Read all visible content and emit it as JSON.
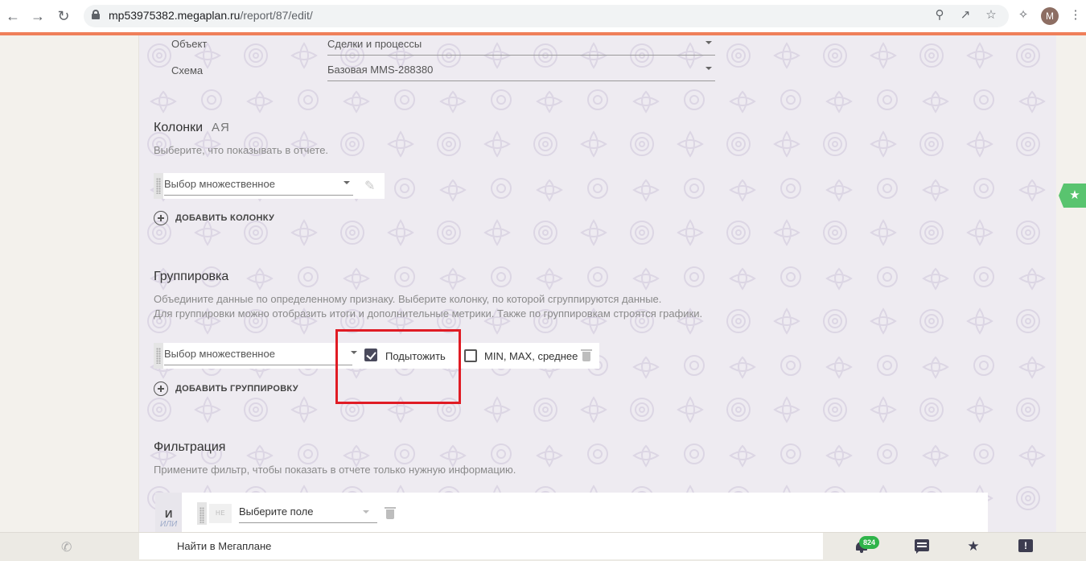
{
  "browser": {
    "url_host": "mp53975382.megaplan.ru",
    "url_path": "/report/87/edit/",
    "profile_initial": "M",
    "icons": [
      "back-icon",
      "forward-icon",
      "reload-icon",
      "lock-icon",
      "zoom-icon",
      "share-icon",
      "bookmark-star-icon",
      "extensions-icon",
      "menu-icon"
    ]
  },
  "form": {
    "object_label": "Объект",
    "object_value": "Сделки и процессы",
    "scheme_label": "Схема",
    "scheme_value": "Базовая MMS-288380"
  },
  "columns": {
    "title": "Колонки",
    "sort_icon_label": "АЯ",
    "description": "Выберите, что показывать в отчете.",
    "field_value": "Выбор множественное",
    "add_label": "ДОБАВИТЬ КОЛОНКУ"
  },
  "grouping": {
    "title": "Группировка",
    "description_line1": "Объедините данные по определенному признаку. Выберите колонку, по которой сгруппируются данные.",
    "description_line2": "Для группировки можно отобразить итоги и дополнительные метрики. Также по группировкам строятся графики.",
    "field_value": "Выбор множественное",
    "subtotal_label": "Подытожить",
    "subtotal_checked": true,
    "metrics_label": "MIN, MAX, среднее",
    "metrics_checked": false,
    "add_label": "ДОБАВИТЬ ГРУППИРОВКУ"
  },
  "filter": {
    "title": "Фильтрация",
    "description": "Примените фильтр, чтобы показать в отчете только нужную информацию.",
    "logic_and": "И",
    "logic_or": "ИЛИ",
    "not_label": "НЕ",
    "field_placeholder": "Выберите поле"
  },
  "bottom_bar": {
    "search_label": "Найти в Мегаплане",
    "notifications_count": "824"
  },
  "colors": {
    "accent_orange": "#ef7f5a",
    "highlight_red": "#e01b24",
    "badge_green": "#2fb44a",
    "bookmark_green": "#59c46f",
    "icon_dark": "#3d3d50"
  }
}
